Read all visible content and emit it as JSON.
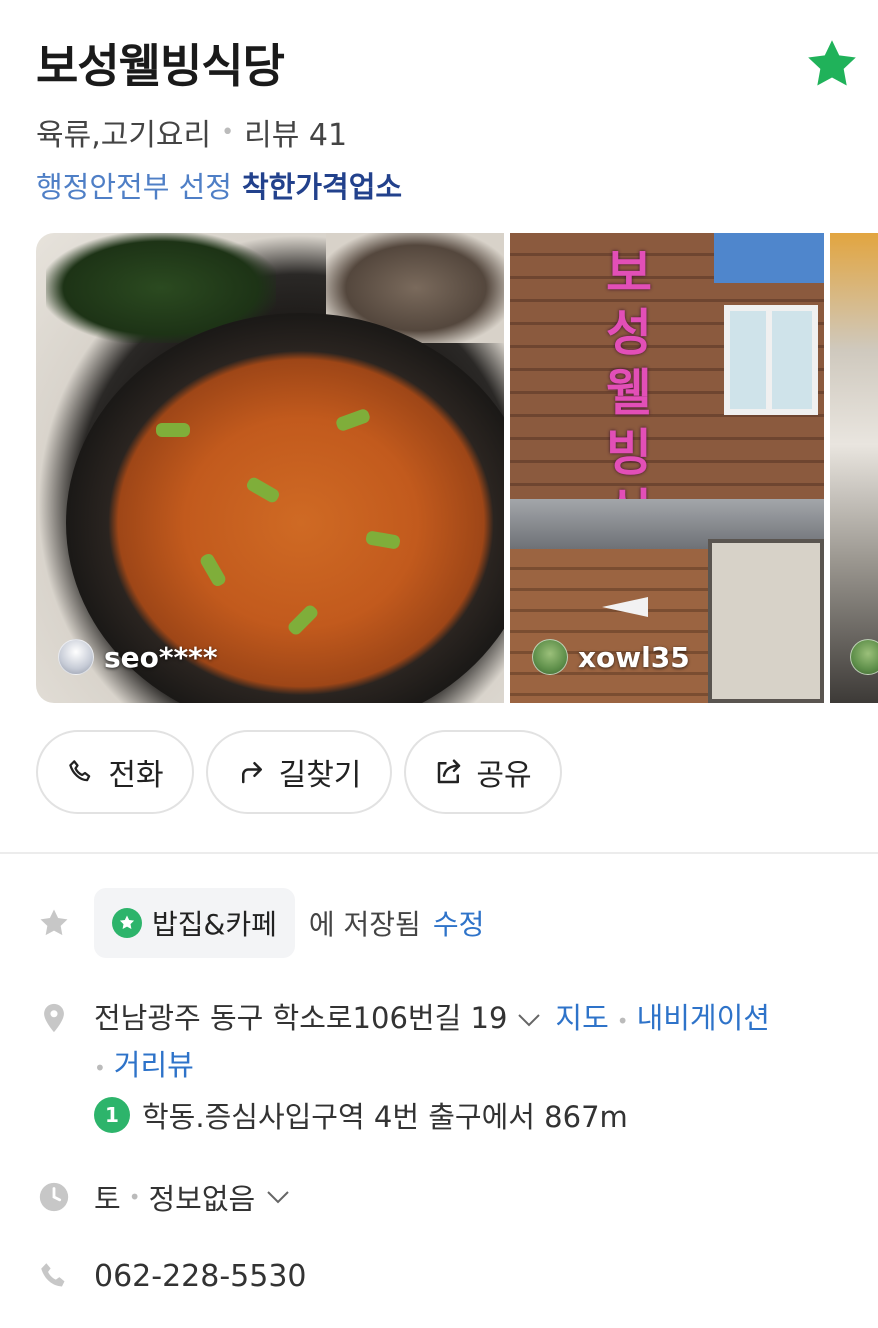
{
  "header": {
    "title": "보성웰빙식당",
    "category": "육류,고기요리",
    "reviews": "리뷰 41",
    "gov_label": "행정안전부 선정",
    "good_price": "착한가격업소",
    "favorite_color": "#20b25a"
  },
  "photos": [
    {
      "user": "seo****"
    },
    {
      "user": "xowl35",
      "sign_text": "보성웰빙식당"
    },
    {
      "user": ""
    }
  ],
  "actions": {
    "call": "전화",
    "directions": "길찾기",
    "share": "공유"
  },
  "saved": {
    "folder": "밥집&카페",
    "suffix": "에 저장됨",
    "edit": "수정"
  },
  "address": {
    "text": "전남광주 동구 학소로106번길 19",
    "map": "지도",
    "navigation": "내비게이션",
    "roadview": "거리뷰",
    "station_line": "1",
    "station_text": "학동.증심사입구역 4번 출구에서 867m"
  },
  "hours": {
    "day": "토",
    "status": "정보없음"
  },
  "phone": "062-228-5530",
  "colors": {
    "link": "#2e73c9",
    "accent_green": "#2db46b"
  }
}
